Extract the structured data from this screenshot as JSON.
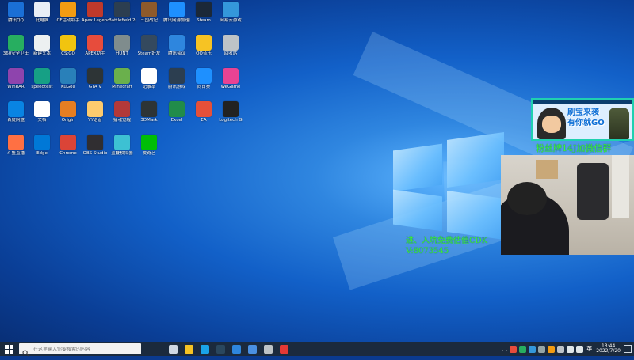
{
  "desktop": {
    "icons": [
      {
        "label": "腾讯QQ",
        "color": "#1a6fd6"
      },
      {
        "label": "此电脑",
        "color": "#e8eef6"
      },
      {
        "label": "CF活动助手",
        "color": "#f39c12"
      },
      {
        "label": "Apex Legends",
        "color": "#c0392b"
      },
      {
        "label": "Battlefield 2042",
        "color": "#2c3e50"
      },
      {
        "label": "三国战记",
        "color": "#8e5a2b"
      },
      {
        "label": "腾讯网游加速器",
        "color": "#1e90ff"
      },
      {
        "label": "Steam",
        "color": "#1b2838"
      },
      {
        "label": "网易云游戏",
        "color": "#3498db"
      },
      {
        "label": "360安全卫士",
        "color": "#27ae60"
      },
      {
        "label": "新建文本",
        "color": "#ecf0f1"
      },
      {
        "label": "CS:GO",
        "color": "#f1c40f"
      },
      {
        "label": "APEX助手",
        "color": "#e74c3c"
      },
      {
        "label": "HUNT",
        "color": "#7f8c8d"
      },
      {
        "label": "Steam好友",
        "color": "#34495e"
      },
      {
        "label": "腾讯会议",
        "color": "#2e86de"
      },
      {
        "label": "QQ音乐",
        "color": "#f6c324"
      },
      {
        "label": "回收站",
        "color": "#bdc3c7"
      },
      {
        "label": "WinRAR",
        "color": "#8e44ad"
      },
      {
        "label": "speedtest",
        "color": "#16a085"
      },
      {
        "label": "KuGou",
        "color": "#2980b9"
      },
      {
        "label": "GTA V",
        "color": "#2d3436"
      },
      {
        "label": "Minecraft",
        "color": "#6ab04c"
      },
      {
        "label": "记事本",
        "color": "#ffffff"
      },
      {
        "label": "腾讯游戏",
        "color": "#2c3e50"
      },
      {
        "label": "向日葵",
        "color": "#1e90ff"
      },
      {
        "label": "WeGame",
        "color": "#e84393"
      },
      {
        "label": "百度网盘",
        "color": "#0984e3"
      },
      {
        "label": "文档",
        "color": "#ffffff"
      },
      {
        "label": "Origin",
        "color": "#e67e22"
      },
      {
        "label": "YY语音",
        "color": "#fdcb6e"
      },
      {
        "label": "猎魂觉醒",
        "color": "#b33939"
      },
      {
        "label": "3DMark",
        "color": "#2d3436"
      },
      {
        "label": "Excel",
        "color": "#218c4a"
      },
      {
        "label": "EA",
        "color": "#e55039"
      },
      {
        "label": "Logitech G",
        "color": "#222222"
      },
      {
        "label": "斗鱼直播",
        "color": "#ff7043"
      },
      {
        "label": "Edge",
        "color": "#0078d7"
      },
      {
        "label": "Chrome",
        "color": "#db4437"
      },
      {
        "label": "OBS Studio",
        "color": "#302e31"
      },
      {
        "label": "蓝叠模拟器",
        "color": "#3dc1d3"
      },
      {
        "label": "爱奇艺",
        "color": "#00be06"
      }
    ]
  },
  "promo_card": {
    "title_line1": "刷宝来袭",
    "title_line2": "有你就GO",
    "fan_text": "粉丝牌14J加微信群"
  },
  "overlay": {
    "line1": "进、入坑免费估值CDK",
    "line2": "V:8073545"
  },
  "taskbar": {
    "search_placeholder": "在这里输入你要搜索的内容",
    "apps": [
      {
        "name": "task-view",
        "color": "#cfd8e3"
      },
      {
        "name": "file-explorer",
        "color": "#f6c324"
      },
      {
        "name": "edge",
        "color": "#1aa3e8"
      },
      {
        "name": "steam",
        "color": "#2a475e"
      },
      {
        "name": "tencent-app",
        "color": "#2e86de"
      },
      {
        "name": "mail",
        "color": "#4a90e2"
      },
      {
        "name": "monitor",
        "color": "#bdc3c7"
      },
      {
        "name": "netease-music",
        "color": "#e53935"
      }
    ],
    "language": "英",
    "time": "13:44",
    "date": "2022/7/20"
  }
}
